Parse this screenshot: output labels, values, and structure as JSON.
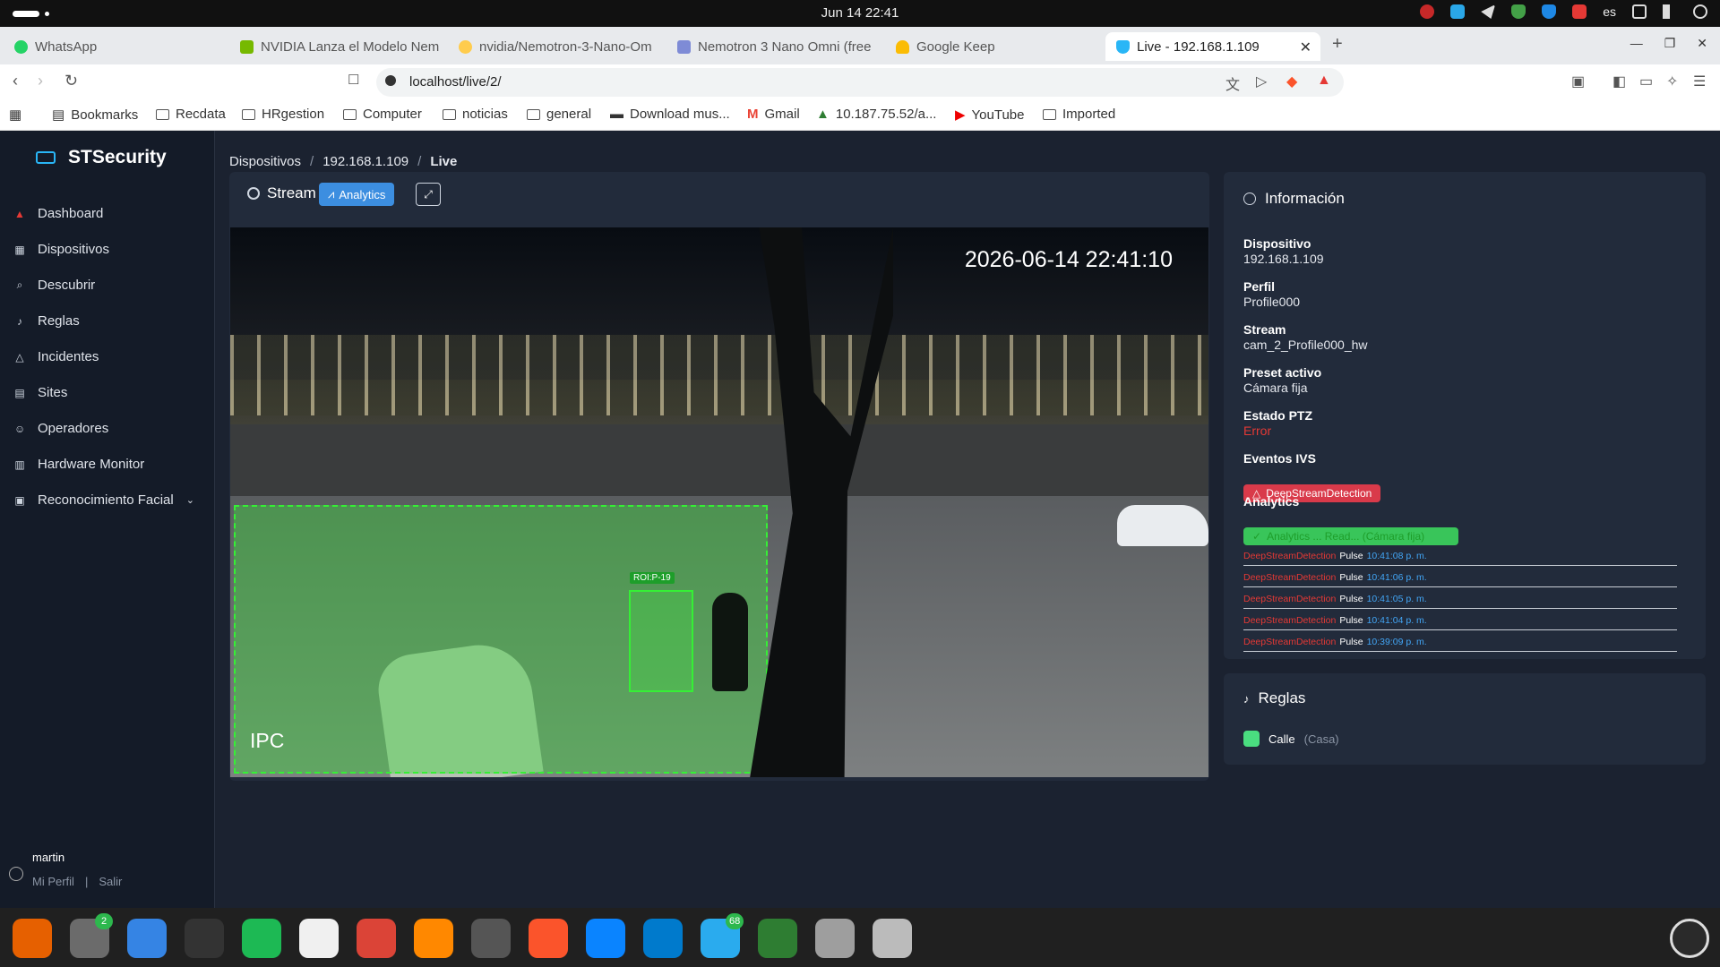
{
  "system": {
    "clock": "Jun 14  22:41",
    "lang": "es"
  },
  "browser": {
    "tabs": [
      {
        "label": "WhatsApp",
        "color": "#25d366"
      },
      {
        "label": "NVIDIA Lanza el Modelo Nem",
        "color": "#76b900"
      },
      {
        "label": "nvidia/Nemotron-3-Nano-Om",
        "color": "#ffcc4d"
      },
      {
        "label": "Nemotron 3 Nano Omni (free",
        "color": "#7e8bd6"
      },
      {
        "label": "Google Keep",
        "color": "#fbbc04"
      },
      {
        "label": "Live - 192.168.1.109",
        "color": "#29b6f6"
      }
    ],
    "url": "localhost/live/2/",
    "bookmarks": [
      {
        "label": "Bookmarks"
      },
      {
        "label": "Recdata"
      },
      {
        "label": "HRgestion"
      },
      {
        "label": "Computer"
      },
      {
        "label": "noticias"
      },
      {
        "label": "general"
      },
      {
        "label": "Download mus..."
      },
      {
        "label": "Gmail"
      },
      {
        "label": "10.187.75.52/a..."
      },
      {
        "label": "YouTube"
      },
      {
        "label": "Imported"
      }
    ]
  },
  "sidebar": {
    "brand": "STSecurity",
    "items": [
      {
        "label": "Dashboard",
        "icon": "alert-triangle-icon",
        "color": "#e53935"
      },
      {
        "label": "Dispositivos",
        "icon": "grid-icon"
      },
      {
        "label": "Descubrir",
        "icon": "search-icon"
      },
      {
        "label": "Reglas",
        "icon": "bell-icon"
      },
      {
        "label": "Incidentes",
        "icon": "warning-icon"
      },
      {
        "label": "Sites",
        "icon": "building-icon"
      },
      {
        "label": "Operadores",
        "icon": "users-icon"
      },
      {
        "label": "Hardware Monitor",
        "icon": "chart-icon"
      },
      {
        "label": "Reconocimiento Facial",
        "icon": "id-card-icon"
      }
    ],
    "user": {
      "name": "martin",
      "profile": "Mi Perfil",
      "logout": "Salir"
    }
  },
  "breadcrumb": [
    "Dispositivos",
    "192.168.1.109",
    "Live"
  ],
  "stream": {
    "title": "Stream",
    "analytics_button": "Analytics",
    "timestamp": "2026-06-14 22:41:10",
    "camera_label": "IPC",
    "roi_label": "ROI:P-19"
  },
  "info": {
    "title": "Información",
    "fields": [
      {
        "label": "Dispositivo",
        "value": "192.168.1.109"
      },
      {
        "label": "Perfil",
        "value": "Profile000"
      },
      {
        "label": "Stream",
        "value": "cam_2_Profile000_hw"
      },
      {
        "label": "Preset activo",
        "value": "Cámara fija"
      },
      {
        "label": "Estado PTZ",
        "value": "Error"
      }
    ],
    "ivs_label": "Eventos IVS",
    "ivs_badge": "DeepStreamDetection",
    "analytics_label": "Analytics",
    "analytics_badge": "Analytics  ...  Read...  (Cámara fija)",
    "events": [
      {
        "name": "DeepStreamDetection",
        "type": "Pulse",
        "time": "10:41:08 p. m."
      },
      {
        "name": "DeepStreamDetection",
        "type": "Pulse",
        "time": "10:41:06 p. m."
      },
      {
        "name": "DeepStreamDetection",
        "type": "Pulse",
        "time": "10:41:05 p. m."
      },
      {
        "name": "DeepStreamDetection",
        "type": "Pulse",
        "time": "10:41:04 p. m."
      },
      {
        "name": "DeepStreamDetection",
        "type": "Pulse",
        "time": "10:39:09 p. m."
      }
    ]
  },
  "rules": {
    "title": "Reglas",
    "items": [
      {
        "name": "Calle",
        "note": "(Casa)"
      }
    ]
  },
  "dock": {
    "apps": [
      {
        "name": "firefox",
        "color": "#e66000"
      },
      {
        "name": "files",
        "color": "#6b6b6b",
        "badge": "2"
      },
      {
        "name": "help",
        "color": "#3584e4"
      },
      {
        "name": "terminal",
        "color": "#333333"
      },
      {
        "name": "spotify",
        "color": "#1db954"
      },
      {
        "name": "text-editor",
        "color": "#f0f0f0"
      },
      {
        "name": "chrome",
        "color": "#db4437"
      },
      {
        "name": "vlc",
        "color": "#ff8800"
      },
      {
        "name": "app-center",
        "color": "#555555"
      },
      {
        "name": "brave",
        "color": "#fb542b"
      },
      {
        "name": "thunderbird",
        "color": "#0a84ff"
      },
      {
        "name": "vscode",
        "color": "#007acc"
      },
      {
        "name": "telegram",
        "color": "#2aabee",
        "badge": "68"
      },
      {
        "name": "camera-viewer",
        "color": "#2e7d32"
      },
      {
        "name": "calculator",
        "color": "#9e9e9e"
      },
      {
        "name": "trash",
        "color": "#bbbbbb"
      }
    ]
  }
}
